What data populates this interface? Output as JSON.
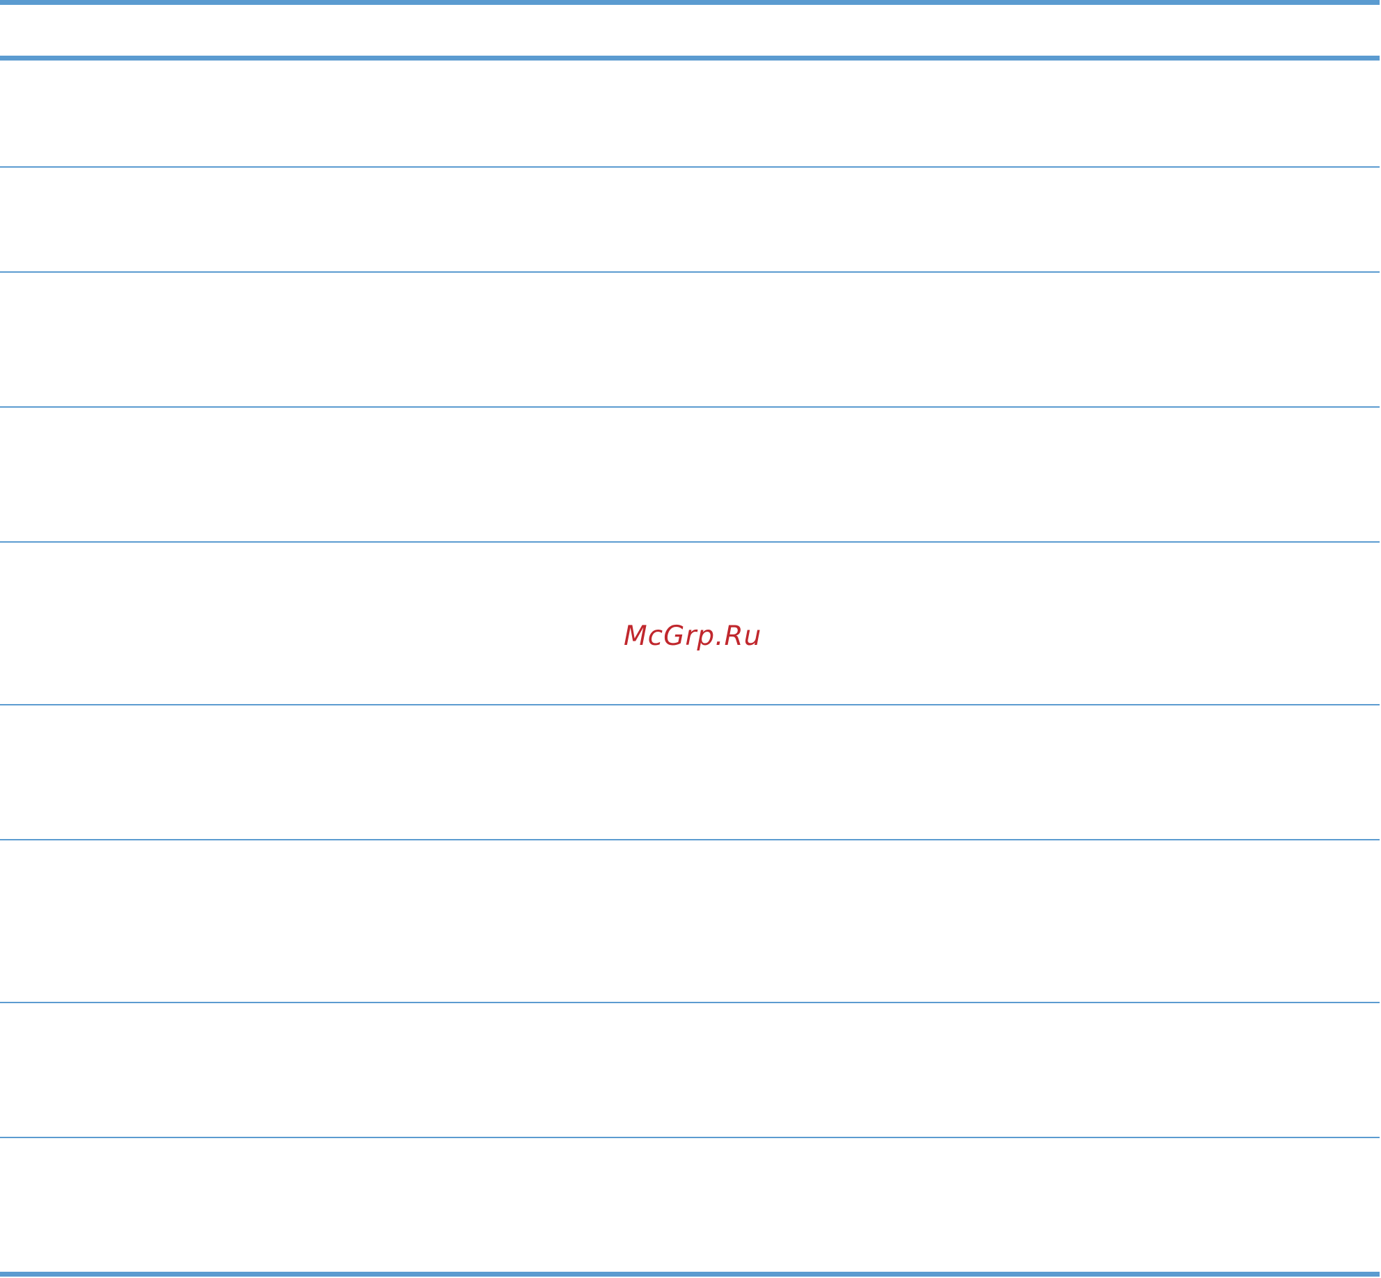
{
  "document": {
    "table": {
      "row_count": 9,
      "header_row_count": 1,
      "rule_color": "#5b9bd0"
    },
    "watermark": {
      "text": "McGrp.Ru",
      "color": "#c0272d"
    }
  }
}
